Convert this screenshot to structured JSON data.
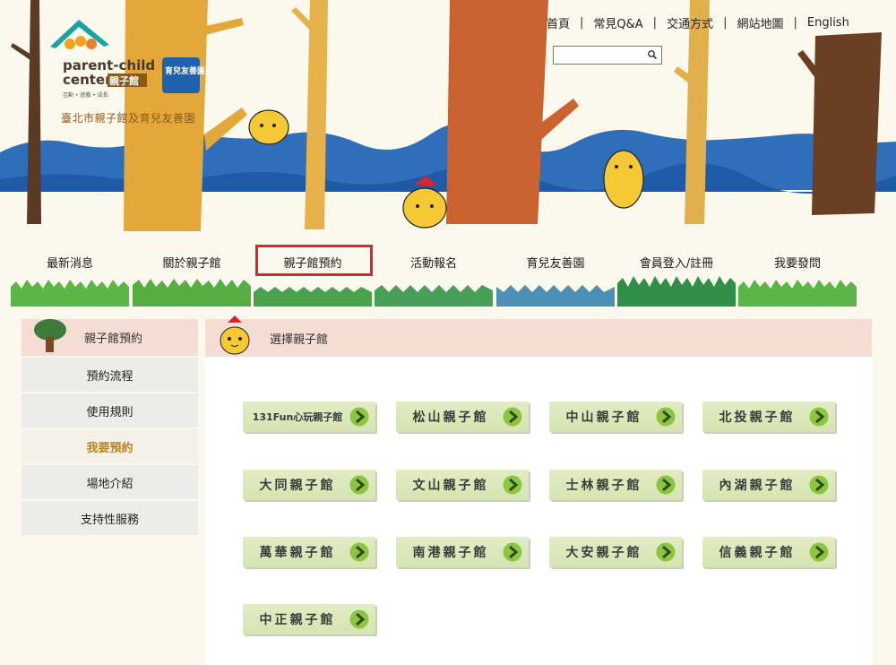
{
  "header": {
    "site_title": "臺北市親子館及育兒友善園",
    "logo": {
      "brand_line1": "parent-child",
      "brand_line2": "center",
      "brand_cn": "親子館",
      "tagline": "互動 • 遊戲 • 成長",
      "badge_text": "育兒友善園"
    },
    "top_links": [
      "首頁",
      "常見Q&A",
      "交通方式",
      "網站地圖",
      "English"
    ],
    "search": {
      "value": "",
      "placeholder": ""
    }
  },
  "nav": {
    "items": [
      {
        "label": "最新消息",
        "color": "#59b044"
      },
      {
        "label": "關於親子館",
        "color": "#59b044"
      },
      {
        "label": "親子館預約",
        "color": "#4a9e50",
        "highlighted": true
      },
      {
        "label": "活動報名",
        "color": "#3f9a5a"
      },
      {
        "label": "育兒友善園",
        "color": "#4a8fb8"
      },
      {
        "label": "會員登入/註冊",
        "color": "#2f8f48"
      },
      {
        "label": "我要發問",
        "color": "#59b044"
      }
    ]
  },
  "sidebar": {
    "title": "親子館預約",
    "items": [
      {
        "label": "預約流程",
        "active": false
      },
      {
        "label": "使用規則",
        "active": false
      },
      {
        "label": "我要預約",
        "active": true
      },
      {
        "label": "場地介紹",
        "active": false
      },
      {
        "label": "支持性服務",
        "active": false
      }
    ]
  },
  "content": {
    "title": "選擇親子館",
    "venues": [
      "131Fun心玩親子館",
      "松山親子館",
      "中山親子館",
      "北投親子館",
      "大同親子館",
      "文山親子館",
      "士林親子館",
      "內湖親子館",
      "萬華親子館",
      "南港親子館",
      "大安親子館",
      "信義親子館",
      "中正親子館"
    ]
  },
  "colors": {
    "accent_active": "#b6862a",
    "highlight_border": "#e0242b",
    "header_band": "#f6ddd4",
    "button_green": "#d6e4b0",
    "arrow_green": "#8cc540"
  }
}
